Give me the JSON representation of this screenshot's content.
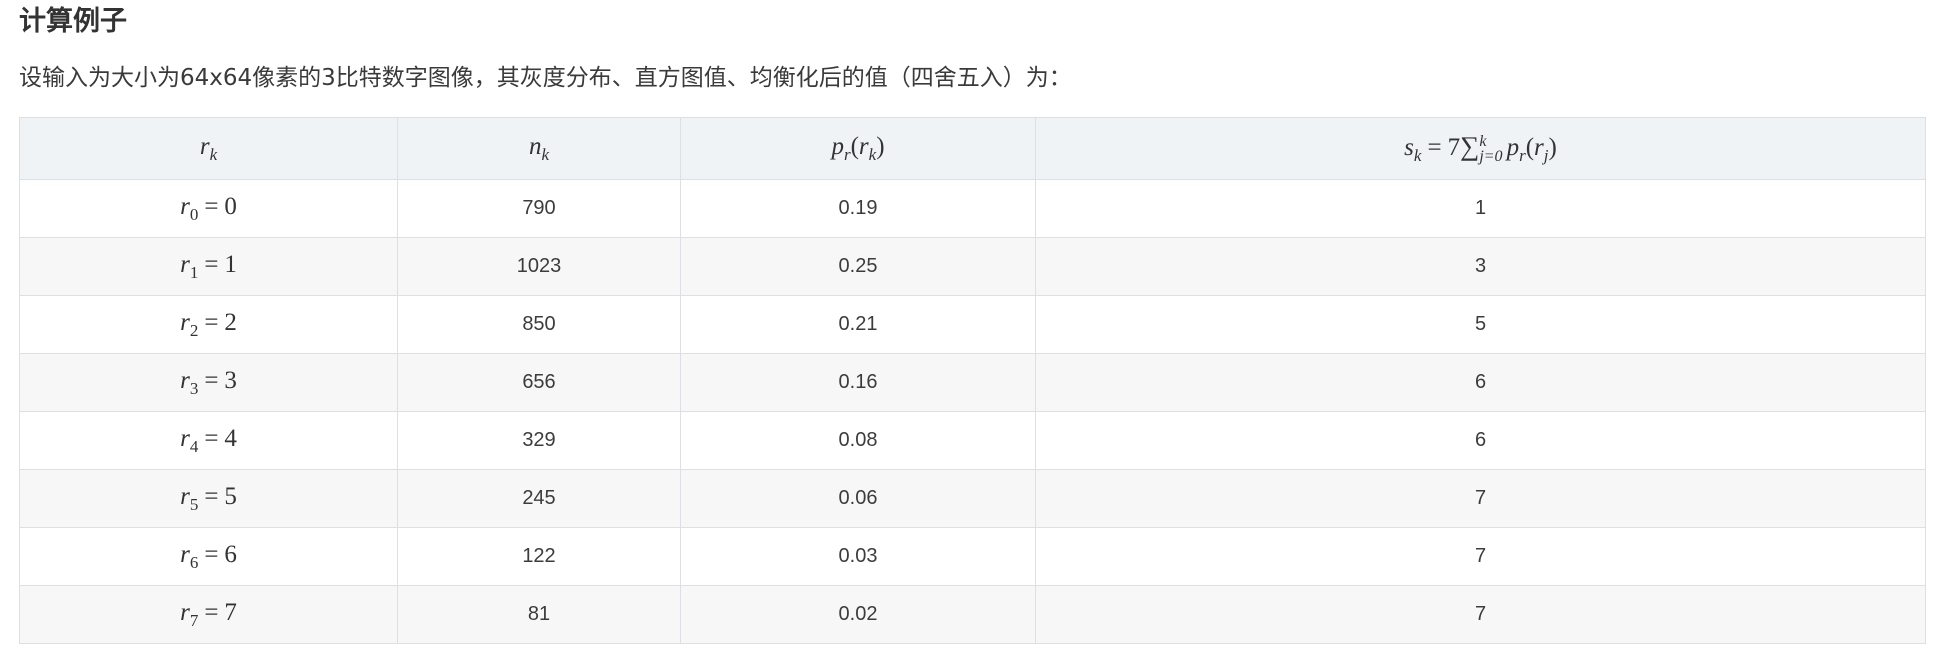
{
  "section_title": "计算例子",
  "intro_text": "设输入为大小为64x64像素的3比特数字图像，其灰度分布、直方图值、均衡化后的值（四舍五入）为：",
  "table": {
    "headers": {
      "rk": "r",
      "rk_sub": "k",
      "nk": "n",
      "nk_sub": "k",
      "pr_p": "p",
      "pr_sub_r": "r",
      "pr_arg": "r",
      "pr_arg_sub": "k",
      "sk_s": "s",
      "sk_sub": "k",
      "sk_eq": "=",
      "sk_coef": "7",
      "sk_sum": "∑",
      "sk_sum_top": "k",
      "sk_sum_bottom": "j=0",
      "sk_p": "p",
      "sk_p_sub": "r",
      "sk_arg": "r",
      "sk_arg_sub": "j"
    },
    "rows": [
      {
        "r_sym": "r",
        "r_idx": "0",
        "r_eq": "=",
        "r_val": "0",
        "nk": "790",
        "pr": "0.19",
        "sk": "1"
      },
      {
        "r_sym": "r",
        "r_idx": "1",
        "r_eq": "=",
        "r_val": "1",
        "nk": "1023",
        "pr": "0.25",
        "sk": "3"
      },
      {
        "r_sym": "r",
        "r_idx": "2",
        "r_eq": "=",
        "r_val": "2",
        "nk": "850",
        "pr": "0.21",
        "sk": "5"
      },
      {
        "r_sym": "r",
        "r_idx": "3",
        "r_eq": "=",
        "r_val": "3",
        "nk": "656",
        "pr": "0.16",
        "sk": "6"
      },
      {
        "r_sym": "r",
        "r_idx": "4",
        "r_eq": "=",
        "r_val": "4",
        "nk": "329",
        "pr": "0.08",
        "sk": "6"
      },
      {
        "r_sym": "r",
        "r_idx": "5",
        "r_eq": "=",
        "r_val": "5",
        "nk": "245",
        "pr": "0.06",
        "sk": "7"
      },
      {
        "r_sym": "r",
        "r_idx": "6",
        "r_eq": "=",
        "r_val": "6",
        "nk": "122",
        "pr": "0.03",
        "sk": "7"
      },
      {
        "r_sym": "r",
        "r_idx": "7",
        "r_eq": "=",
        "r_val": "7",
        "nk": "81",
        "pr": "0.02",
        "sk": "7"
      }
    ]
  }
}
